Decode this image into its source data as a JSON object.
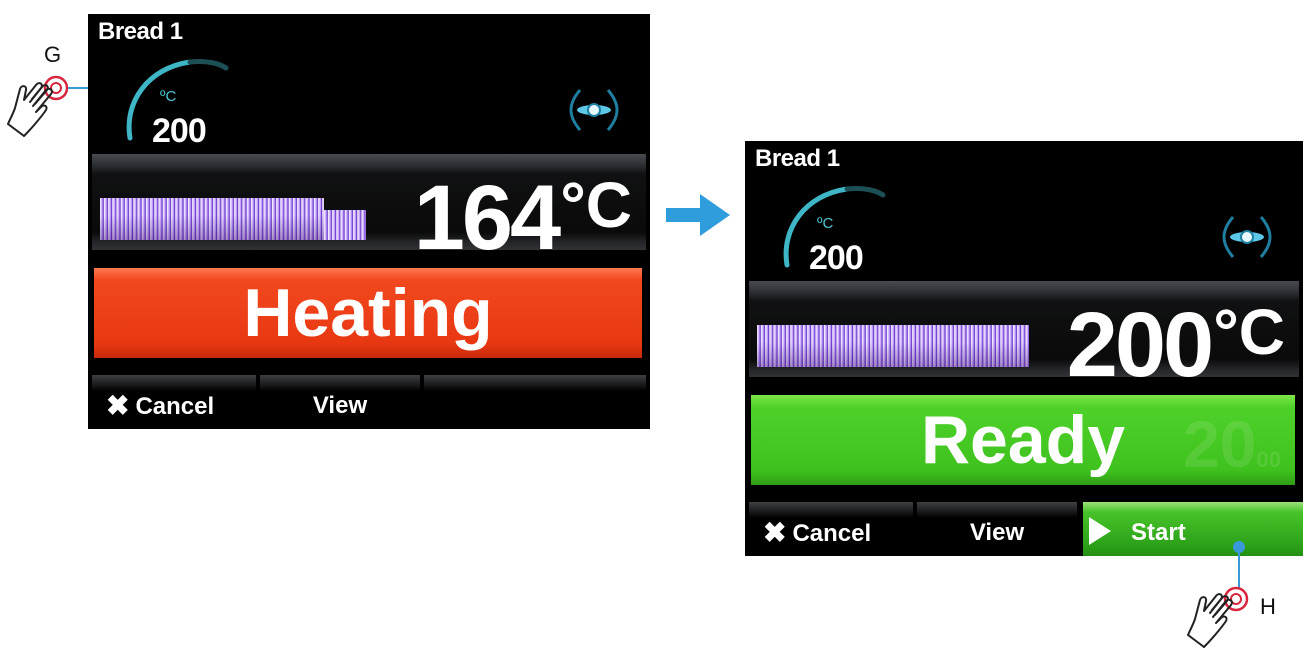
{
  "screen_before": {
    "program": "Bread 1",
    "setpoint_unit": "ºC",
    "setpoint_value": "200",
    "current_temp": "164",
    "temp_unit": "°C",
    "status": "Heating",
    "status_color": "#e8401a",
    "softkeys": {
      "cancel": "Cancel",
      "view": "View"
    }
  },
  "screen_after": {
    "program": "Bread 1",
    "setpoint_unit": "ºC",
    "setpoint_value": "200",
    "current_temp": "200",
    "temp_unit": "°C",
    "status": "Ready",
    "status_color": "#45c824",
    "timer_ghost": "20",
    "timer_ghost_small": "00",
    "softkeys": {
      "cancel": "Cancel",
      "view": "View",
      "start": "Start"
    }
  },
  "callouts": {
    "g": "G",
    "h": "H"
  },
  "accent_color": "#3a9ad9"
}
